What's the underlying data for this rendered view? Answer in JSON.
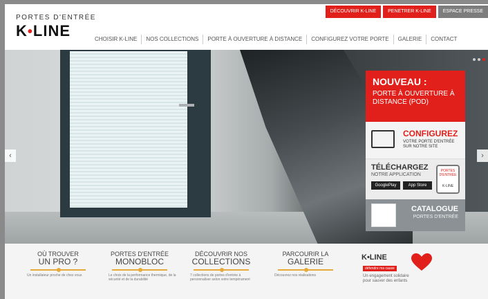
{
  "logo": {
    "sub": "PORTES D'ENTRÉE",
    "main_left": "K",
    "main_right": "LINE"
  },
  "top_buttons": [
    "DÉCOUVRIR K-LINE",
    "PENETRER K-LINE",
    "ESPACE PRESSE"
  ],
  "nav": [
    "CHOISIR K-LINE",
    "NOS COLLECTIONS",
    "PORTE À OUVERTURE À DISTANCE",
    "CONFIGUREZ VOTRE PORTE",
    "GALERIE",
    "CONTACT"
  ],
  "panel": {
    "new_title": "NOUVEAU :",
    "new_sub": "PORTE À OUVERTURE À DISTANCE (POD)",
    "config_title": "CONFIGUREZ",
    "config_sub": "VOTRE PORTE D'ENTRÉE SUR NOTRE SITE",
    "dl_title": "TÉLÉCHARGEZ",
    "dl_sub": "NOTRE APPLICATION",
    "store1": "GooglePlay",
    "store2": "App Store",
    "phone_text1": "PORTES D'ENTRÉE",
    "phone_text2": "K-LINE",
    "cat_title": "CATALOGUE",
    "cat_sub": "PORTES D'ENTRÉE"
  },
  "features": [
    {
      "h1": "OÙ TROUVER",
      "h2": "UN PRO ?",
      "desc": "Un installateur proche de chez vous"
    },
    {
      "h1": "PORTES D'ENTRÉE",
      "h2": "MONOBLOC",
      "desc": "Le choix de la performance thermique, de la sécurité et de la durabilité"
    },
    {
      "h1": "DÉCOUVRIR NOS",
      "h2": "COLLECTIONS",
      "desc": "7 collections de portes d'entrée à personnaliser selon votre tempérament"
    },
    {
      "h1": "PARCOURIR LA",
      "h2": "GALERIE",
      "desc": "Découvrez nos réalisations"
    }
  ],
  "kline2": {
    "logo": "K•LINE",
    "badge": "défendre ma cause",
    "desc": "Un engagement solidaire pour sauver des enfants"
  },
  "colors": {
    "accent": "#e1201b",
    "gold": "#e6a93a"
  }
}
